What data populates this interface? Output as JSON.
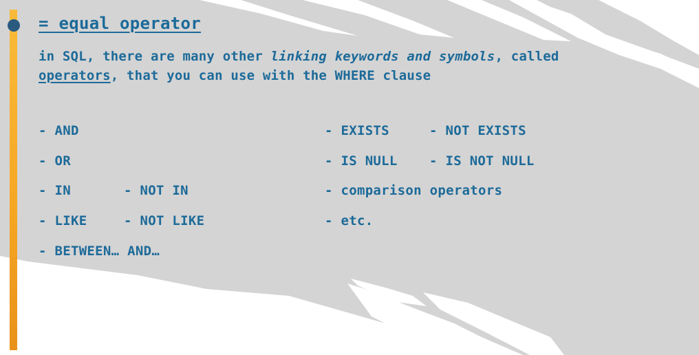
{
  "slide": {
    "title": "= equal operator",
    "intro": {
      "part1": "in SQL, there are many other ",
      "italic": "linking keywords and symbols",
      "part2": ", called",
      "underlined": "operators",
      "part3": ", that you can use with the WHERE clause"
    },
    "left_column": [
      {
        "primary": "- AND",
        "secondary": ""
      },
      {
        "primary": "- OR",
        "secondary": ""
      },
      {
        "primary": "- IN",
        "secondary": "- NOT IN"
      },
      {
        "primary": "- LIKE",
        "secondary": "- NOT LIKE"
      },
      {
        "primary": "- BETWEEN… AND…",
        "secondary": ""
      }
    ],
    "right_column": [
      {
        "primary": "- EXISTS",
        "secondary": "- NOT EXISTS"
      },
      {
        "primary": "- IS NULL",
        "secondary": "- IS NOT NULL"
      },
      {
        "primary": "- comparison operators",
        "secondary": ""
      },
      {
        "primary": "- etc.",
        "secondary": ""
      }
    ]
  },
  "colors": {
    "text": "#1c6a99",
    "accent_bar": "#f5a623",
    "bullet_dot": "#2b5a7f",
    "background_stroke": "#d3d3d3"
  }
}
